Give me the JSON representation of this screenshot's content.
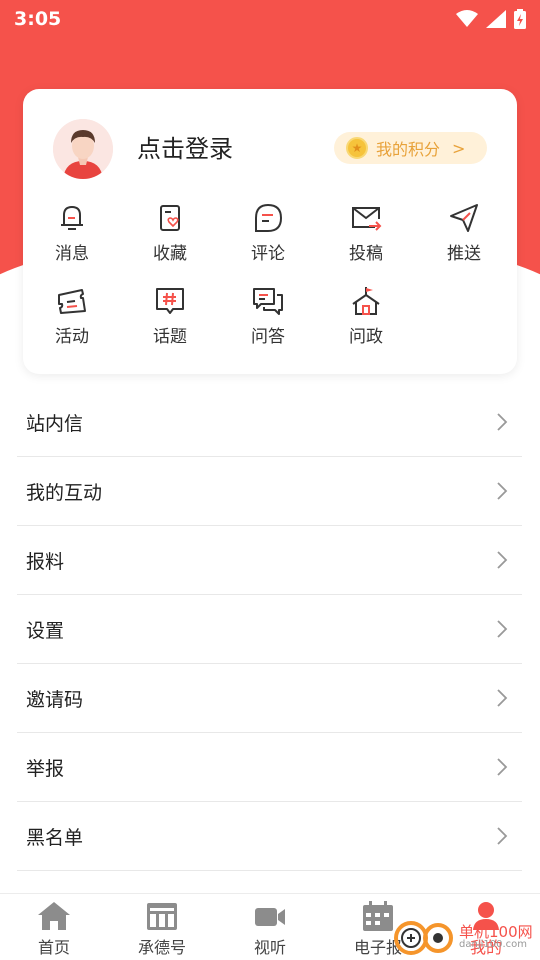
{
  "status_bar": {
    "time": "3:05"
  },
  "profile": {
    "login_prompt": "点击登录",
    "points_label": "我的积分",
    "points_arrow": ">"
  },
  "quick_actions": [
    {
      "label": "消息",
      "icon": "bell-icon"
    },
    {
      "label": "收藏",
      "icon": "bookmark-heart-icon"
    },
    {
      "label": "评论",
      "icon": "comment-icon"
    },
    {
      "label": "投稿",
      "icon": "mail-send-icon"
    },
    {
      "label": "推送",
      "icon": "paper-plane-icon"
    },
    {
      "label": "活动",
      "icon": "ticket-icon"
    },
    {
      "label": "话题",
      "icon": "hashtag-icon"
    },
    {
      "label": "问答",
      "icon": "qa-bubbles-icon"
    },
    {
      "label": "问政",
      "icon": "government-building-icon"
    }
  ],
  "menu": [
    {
      "label": "站内信"
    },
    {
      "label": "我的互动"
    },
    {
      "label": "报料"
    },
    {
      "label": "设置"
    },
    {
      "label": "邀请码"
    },
    {
      "label": "举报"
    },
    {
      "label": "黑名单"
    }
  ],
  "bottom_nav": [
    {
      "label": "首页",
      "icon": "home-icon"
    },
    {
      "label": "承德号",
      "icon": "newspaper-icon"
    },
    {
      "label": "视听",
      "icon": "video-camera-icon"
    },
    {
      "label": "电子报",
      "icon": "calendar-icon"
    },
    {
      "label": "我的",
      "icon": "user-icon",
      "active": true
    }
  ],
  "watermark": {
    "title": "单机100网",
    "url": "danji100.com"
  },
  "colors": {
    "accent": "#f5524b",
    "points_bg": "#fff1d9",
    "points_text": "#e8a23a"
  }
}
